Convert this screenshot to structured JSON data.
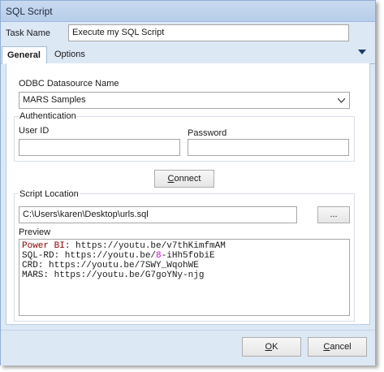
{
  "window": {
    "title": "SQL Script"
  },
  "task": {
    "label": "Task Name",
    "value": "Execute my SQL Script"
  },
  "tabs": [
    {
      "label": "General"
    },
    {
      "label": "Options"
    }
  ],
  "odbc": {
    "label": "ODBC Datasource Name",
    "selected": "MARS Samples"
  },
  "auth": {
    "group_label": "Authentication",
    "user_label": "User ID",
    "user_value": "",
    "password_label": "Password",
    "password_value": ""
  },
  "connect_button": {
    "label": "Connect",
    "mnemonic": "C",
    "rest": "onnect"
  },
  "script": {
    "label": "Script Location",
    "path": "C:\\Users\\karen\\Desktop\\urls.sql",
    "browse_label": "..."
  },
  "preview": {
    "label": "Preview",
    "lines": [
      {
        "kw": "Power BI",
        "rest": ": https://youtu.be/v7thKimfmAM"
      },
      {
        "kw": "SQL-RD",
        "mid": ": https://youtu.be/",
        "num": "8",
        "rest": "-iHh5fobiE"
      },
      {
        "kw": "CRD",
        "rest": ": https://youtu.be/7SWY_WqohWE"
      },
      {
        "kw": "MARS",
        "rest": ": https://youtu.be/G7goYNy-njg"
      }
    ]
  },
  "footer": {
    "ok": {
      "label": "OK",
      "mnemonic": "O",
      "rest": "K"
    },
    "cancel": {
      "label": "Cancel",
      "mnemonic": "C",
      "rest": "ancel"
    }
  },
  "colors": {
    "title_bg": "#c9daf0",
    "window_bg": "#dde8f5",
    "keyword": "#8b0000",
    "number": "#d000d0"
  },
  "icons": {
    "tab_menu": "triangle-down-icon",
    "dropdown": "chevron-down-icon"
  }
}
